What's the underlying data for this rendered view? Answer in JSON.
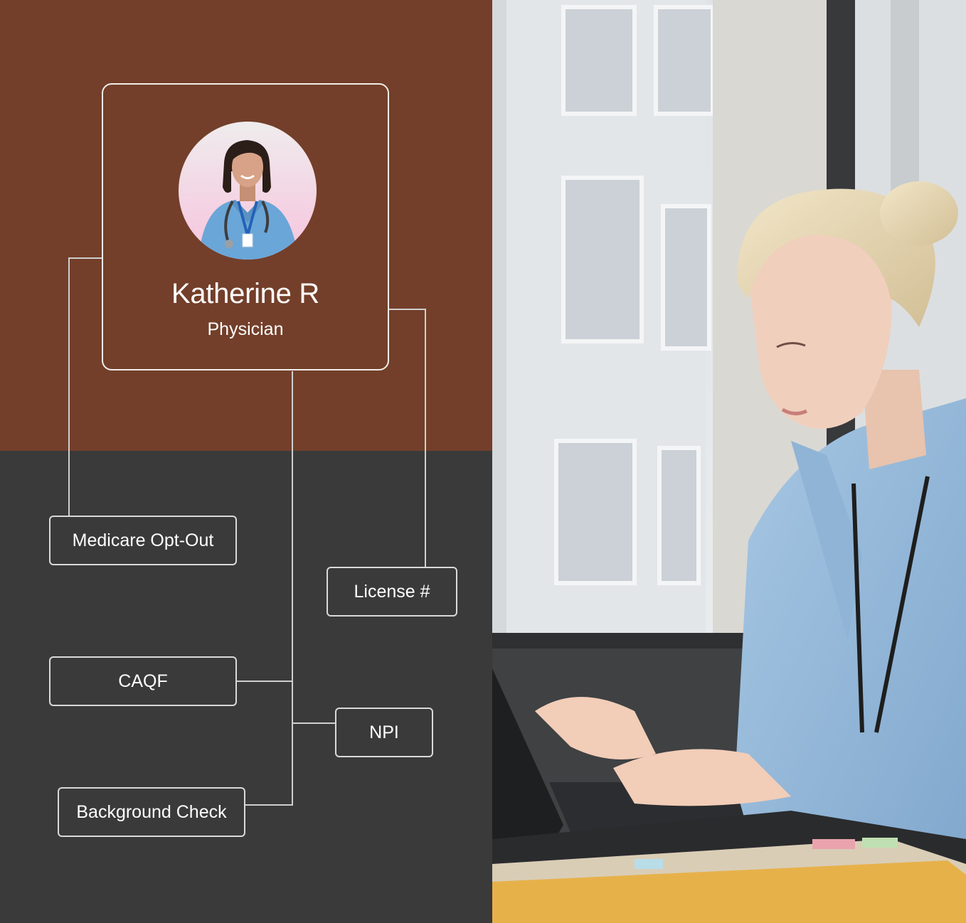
{
  "profile": {
    "name": "Katherine R",
    "role": "Physician"
  },
  "credentials": {
    "medicare_opt_out": "Medicare Opt-Out",
    "license": "License #",
    "caqf": "CAQF",
    "npi": "NPI",
    "background_check": "Background Check"
  },
  "colors": {
    "brown": "#733f2a",
    "charcoal": "#3a3a3a",
    "line": "#d9d9d9"
  }
}
